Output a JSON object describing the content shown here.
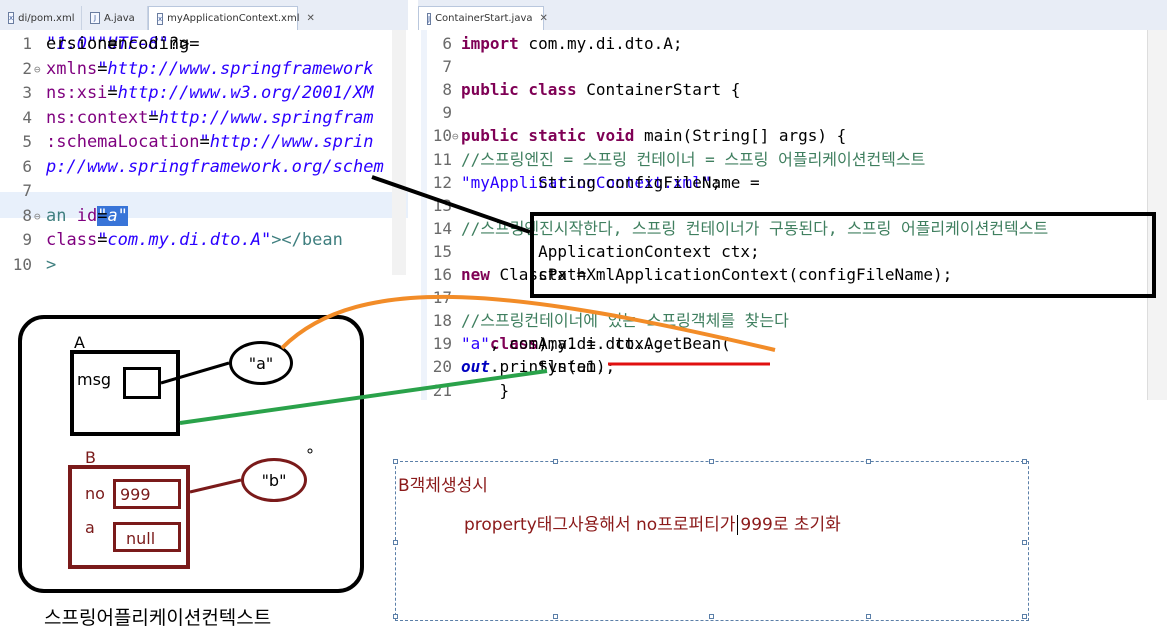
{
  "left_editor": {
    "tabs": [
      {
        "label": "di/pom.xml",
        "icon": "xml-file-icon"
      },
      {
        "label": "A.java",
        "icon": "java-file-icon"
      },
      {
        "label": "myApplicationContext.xml",
        "icon": "xml-file-icon",
        "active": true
      }
    ],
    "lines": [
      {
        "n": "1",
        "fold": "",
        "segs": [
          [
            "cl",
            "ersion="
          ],
          [
            "strI",
            "\"1.0\""
          ],
          [
            "cl",
            " encoding="
          ],
          [
            "strI",
            "\"UTF-8\""
          ],
          [
            "cl",
            "?>"
          ]
        ]
      },
      {
        "n": "2",
        "fold": "⊖",
        "segs": [
          [
            "attr",
            "xmlns"
          ],
          [
            "cl",
            "="
          ],
          [
            "strI",
            "\"http://www.springframework"
          ]
        ]
      },
      {
        "n": "3",
        "fold": "",
        "segs": [
          [
            "attr",
            "ns:xsi"
          ],
          [
            "cl",
            "="
          ],
          [
            "strI",
            "\"http://www.w3.org/2001/XM"
          ]
        ]
      },
      {
        "n": "4",
        "fold": "",
        "segs": [
          [
            "attr",
            "ns:context"
          ],
          [
            "cl",
            "="
          ],
          [
            "strI",
            "\"http://www.springfram"
          ]
        ]
      },
      {
        "n": "5",
        "fold": "",
        "segs": [
          [
            "attr",
            ":schemaLocation"
          ],
          [
            "cl",
            "="
          ],
          [
            "strI",
            "\"http://www.sprin"
          ]
        ]
      },
      {
        "n": "6",
        "fold": "",
        "segs": [
          [
            "strI",
            "p://www.springframework.org/schem"
          ]
        ]
      },
      {
        "n": "7",
        "fold": "",
        "segs": []
      },
      {
        "n": "8",
        "fold": "⊖",
        "segs": [
          [
            "tagc",
            "an "
          ],
          [
            "attr",
            "id"
          ],
          [
            "cl",
            "="
          ],
          [
            "sel",
            "\"a\""
          ]
        ]
      },
      {
        "n": "9",
        "fold": "",
        "segs": [
          [
            "cl",
            "   "
          ],
          [
            "attr",
            "class"
          ],
          [
            "cl",
            "="
          ],
          [
            "strI",
            "\"com.my.di.dto.A\""
          ],
          [
            "tagc",
            "></bean"
          ]
        ]
      },
      {
        "n": "10",
        "fold": "",
        "segs": [
          [
            "tagc",
            ">"
          ]
        ]
      }
    ]
  },
  "right_editor": {
    "tabs": [
      {
        "label": "ContainerStart.java",
        "icon": "java-file-icon",
        "active": true
      }
    ],
    "lines": [
      {
        "n": "6",
        "segs": [
          [
            "kw",
            "import"
          ],
          [
            "cl",
            " com.my.di.dto.A;"
          ]
        ]
      },
      {
        "n": "7",
        "segs": []
      },
      {
        "n": "8",
        "segs": [
          [
            "kw",
            "public class"
          ],
          [
            "cl",
            " ContainerStart {"
          ]
        ]
      },
      {
        "n": "9",
        "segs": []
      },
      {
        "n": "10",
        "fold": "⊖",
        "segs": [
          [
            "cl",
            "    "
          ],
          [
            "kw",
            "public static void"
          ],
          [
            "cl",
            " main(String[] args) {"
          ]
        ]
      },
      {
        "n": "11",
        "segs": [
          [
            "cl",
            "        "
          ],
          [
            "cmt",
            "//스프링엔진 = 스프링 컨테이너 = 스프링 어플리케이션컨텍스트"
          ]
        ]
      },
      {
        "n": "12",
        "segs": [
          [
            "cl",
            "        String configFileName = "
          ],
          [
            "str",
            "\"myApplicationContext.xml\""
          ],
          [
            "cl",
            ";"
          ]
        ]
      },
      {
        "n": "13",
        "segs": []
      },
      {
        "n": "14",
        "segs": [
          [
            "cl",
            "        "
          ],
          [
            "cmt",
            "//스프링엔진시작한다, 스프링 컨테이너가 구동된다, 스프링 어플리케이션컨텍스트"
          ]
        ]
      },
      {
        "n": "15",
        "segs": [
          [
            "cl",
            "        ApplicationContext ctx;"
          ]
        ]
      },
      {
        "n": "16",
        "segs": [
          [
            "cl",
            "        ctx = "
          ],
          [
            "kw",
            "new"
          ],
          [
            "cl",
            " ClassPathXmlApplicationContext(configFileName);"
          ]
        ]
      },
      {
        "n": "17",
        "segs": []
      },
      {
        "n": "18",
        "segs": [
          [
            "cl",
            "        "
          ],
          [
            "cmt",
            "//스프링컨테이너에 있는 스프링객체를 찾는다"
          ]
        ]
      },
      {
        "n": "19",
        "segs": [
          [
            "cl",
            "        A a1 =  ctx.getBean("
          ],
          [
            "str",
            "\"a\""
          ],
          [
            "cl",
            ", com.my.di.dto.A."
          ],
          [
            "kw",
            "class"
          ],
          [
            "cl",
            ");"
          ]
        ]
      },
      {
        "n": "20",
        "segs": [
          [
            "cl",
            "        System."
          ],
          [
            "fld",
            "out"
          ],
          [
            "cl",
            ".println(a1);"
          ]
        ]
      },
      {
        "n": "21",
        "segs": [
          [
            "cl",
            "    }"
          ]
        ]
      }
    ]
  },
  "diagram": {
    "class_a": {
      "name": "A",
      "field": "msg"
    },
    "ref_a": "\"a\"",
    "class_b": {
      "name": "B",
      "field_no": "no",
      "value_no": "999",
      "field_a": "a",
      "value_a": "null"
    },
    "ref_b": "\"b\"",
    "container_caption": "스프링어플리케이션컨텍스트",
    "colors": {
      "orange": "#f28c28",
      "green": "#2aa24a",
      "darkred": "#7a1a1a",
      "red_underline": "#e01010"
    }
  },
  "note": {
    "title": "B객체생성시",
    "body_before_caret": "property태그사용해서 no프로퍼티가",
    "body_after_caret": "999로 초기화"
  }
}
